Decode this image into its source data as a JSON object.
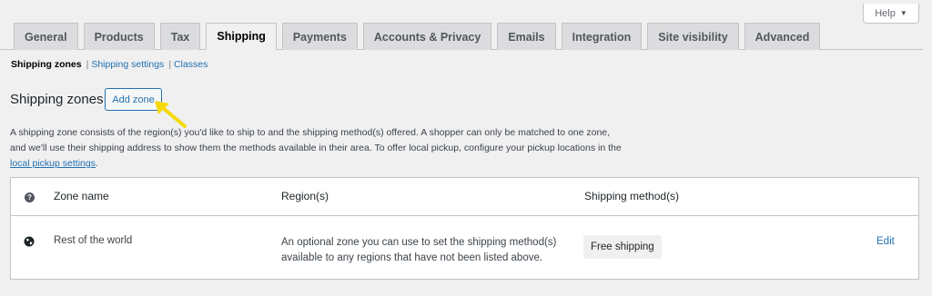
{
  "help": {
    "label": "Help",
    "caret": "▼"
  },
  "tabs": [
    {
      "label": "General",
      "active": false
    },
    {
      "label": "Products",
      "active": false
    },
    {
      "label": "Tax",
      "active": false
    },
    {
      "label": "Shipping",
      "active": true
    },
    {
      "label": "Payments",
      "active": false
    },
    {
      "label": "Accounts & Privacy",
      "active": false
    },
    {
      "label": "Emails",
      "active": false
    },
    {
      "label": "Integration",
      "active": false
    },
    {
      "label": "Site visibility",
      "active": false
    },
    {
      "label": "Advanced",
      "active": false
    }
  ],
  "subnav": {
    "current": "Shipping zones",
    "sep": "|",
    "settings": "Shipping settings",
    "classes": "Classes"
  },
  "page": {
    "heading": "Shipping zones",
    "add_zone": "Add zone"
  },
  "description": {
    "text_before": "A shipping zone consists of the region(s) you'd like to ship to and the shipping method(s) offered. A shopper can only be matched to one zone, and we'll use their shipping address to show them the methods available in their area. To offer local pickup, configure your pickup locations in the ",
    "link": "local pickup settings",
    "text_after": "."
  },
  "table": {
    "headers": {
      "zone_name": "Zone name",
      "regions": "Region(s)",
      "methods": "Shipping method(s)"
    },
    "rows": [
      {
        "zone_name": "Rest of the world",
        "regions": "An optional zone you can use to set the shipping method(s) available to any regions that have not been listed above.",
        "method": "Free shipping",
        "action": "Edit"
      }
    ]
  },
  "colors": {
    "accent": "#2271b1",
    "highlight_arrow": "#f5d90a"
  },
  "icons": {
    "help_caret": "caret-down-icon",
    "header_help": "question-icon",
    "zone_row": "globe-icon",
    "annotation": "pointer-arrow-icon"
  }
}
